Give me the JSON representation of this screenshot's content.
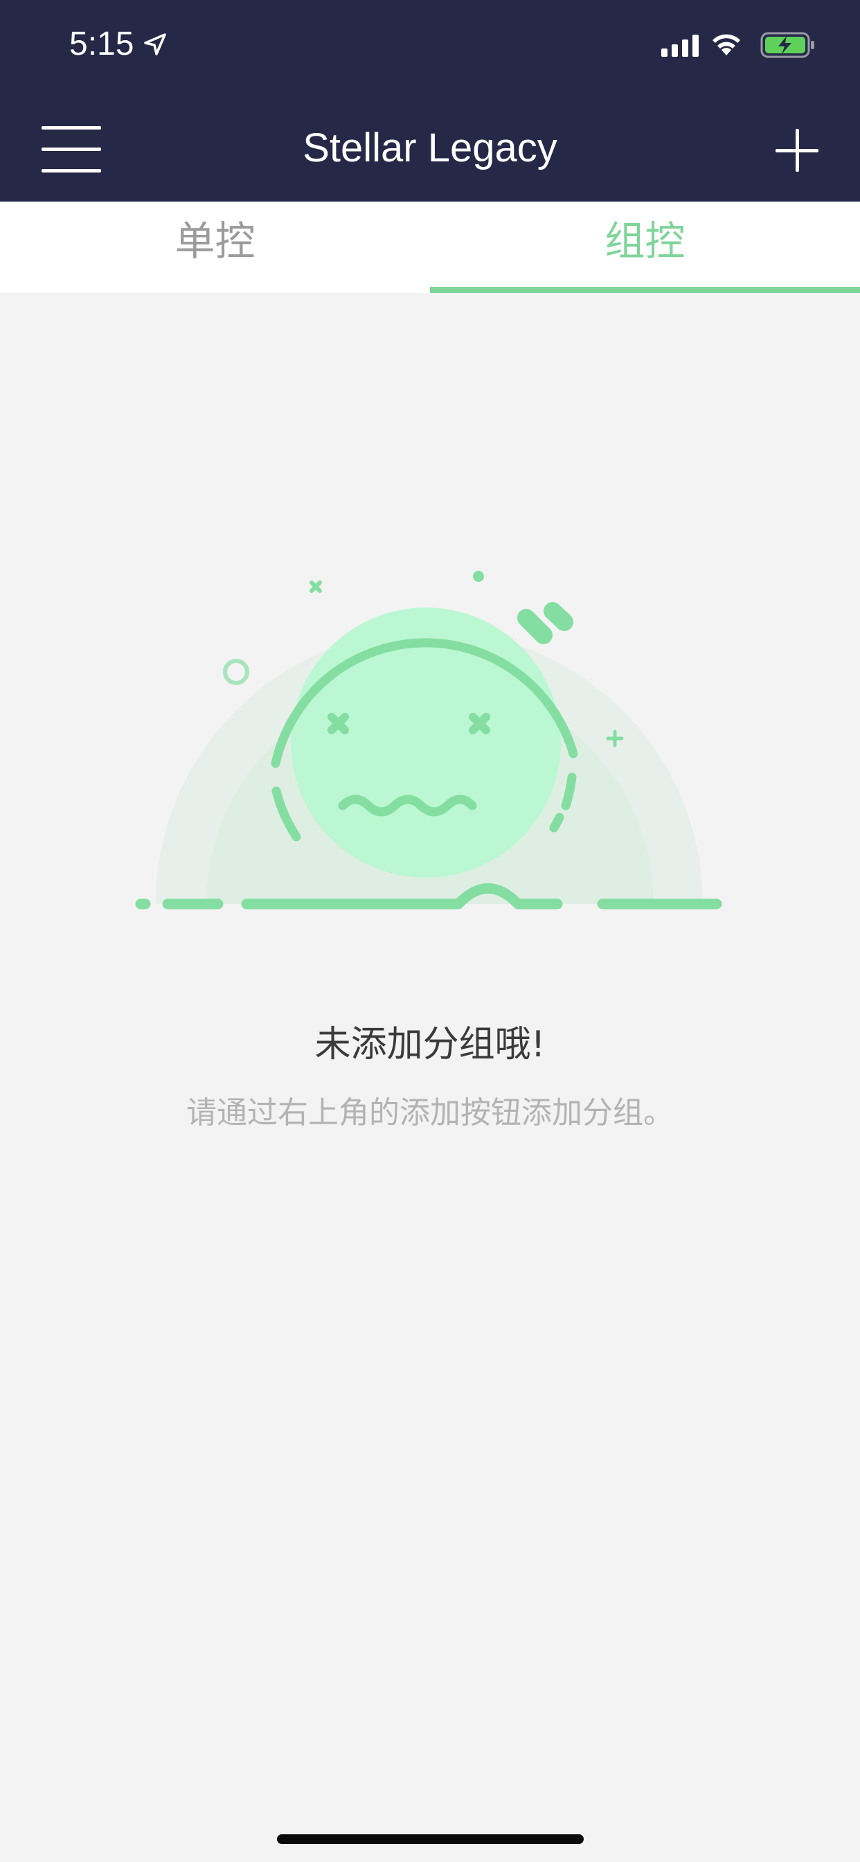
{
  "status_bar": {
    "time": "5:15",
    "icons": [
      "location-arrow-icon",
      "signal-icon",
      "wifi-icon",
      "battery-charging-icon"
    ]
  },
  "header": {
    "title": "Stellar Legacy",
    "left_icon": "menu-icon",
    "right_icon": "add-icon"
  },
  "tabs": [
    {
      "label": "单控",
      "active": false
    },
    {
      "label": "组控",
      "active": true
    }
  ],
  "empty_state": {
    "illustration": "dizzy-face-icon",
    "title": "未添加分组哦!",
    "description": "请通过右上角的添加按钮添加分组。"
  },
  "colors": {
    "header_bg": "#252846",
    "accent": "#7fd49a",
    "background": "#f3f3f3",
    "inactive_tab": "#9b9b9b"
  }
}
